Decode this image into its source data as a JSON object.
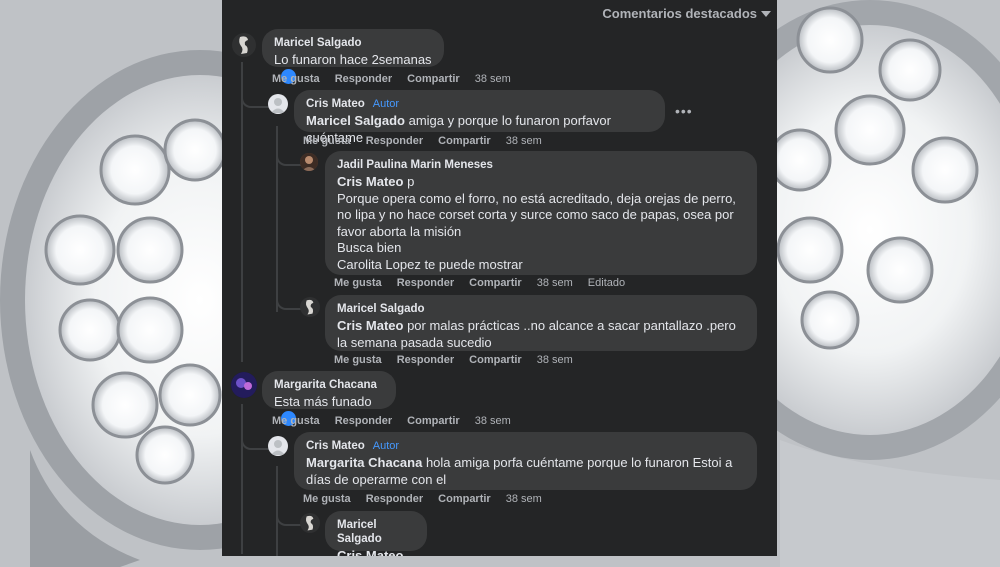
{
  "header": {
    "sort_label": "Comentarios destacados"
  },
  "actions": {
    "like": "Me gusta",
    "reply": "Responder",
    "share": "Compartir"
  },
  "comments": [
    {
      "author": "Maricel Salgado",
      "badge": "",
      "mention": "",
      "text": "Lo funaron hace 2semanas",
      "time": "38 sem",
      "edited": "",
      "reaction": "like-icon"
    },
    {
      "author": "Cris Mateo",
      "badge": "Autor",
      "mention": "Maricel Salgado",
      "text": " amiga y porque lo funaron porfavor cuéntame",
      "time": "38 sem",
      "edited": ""
    },
    {
      "author": "Jadil Paulina Marin Meneses",
      "badge": "",
      "mention": "Cris Mateo",
      "text": " p\nPorque opera como el forro, no está acreditado, deja orejas de perro, no lipa y no hace corset corta y surce como saco de papas, osea por favor aborta la misión\nBusca bien\nCarolita Lopez te puede mostrar",
      "time": "38 sem",
      "edited": "Editado"
    },
    {
      "author": "Maricel Salgado",
      "badge": "",
      "mention": "Cris Mateo",
      "text": " por malas prácticas ..no alcance a sacar pantallazo .pero la semana pasada sucedio",
      "time": "38 sem",
      "edited": ""
    },
    {
      "author": "Margarita Chacana",
      "badge": "",
      "mention": "",
      "text": "Esta más funado",
      "time": "38 sem",
      "edited": "",
      "reaction": "like-icon"
    },
    {
      "author": "Cris Mateo",
      "badge": "Autor",
      "mention": "Margarita Chacana",
      "text": " hola amiga porfa cuéntame porque lo funaron Estoi a días de operarme con el",
      "time": "38 sem",
      "edited": ""
    },
    {
      "author": "Maricel Salgado",
      "badge": "",
      "mention": "Cris Mateo",
      "text": "",
      "time": "",
      "edited": ""
    }
  ]
}
